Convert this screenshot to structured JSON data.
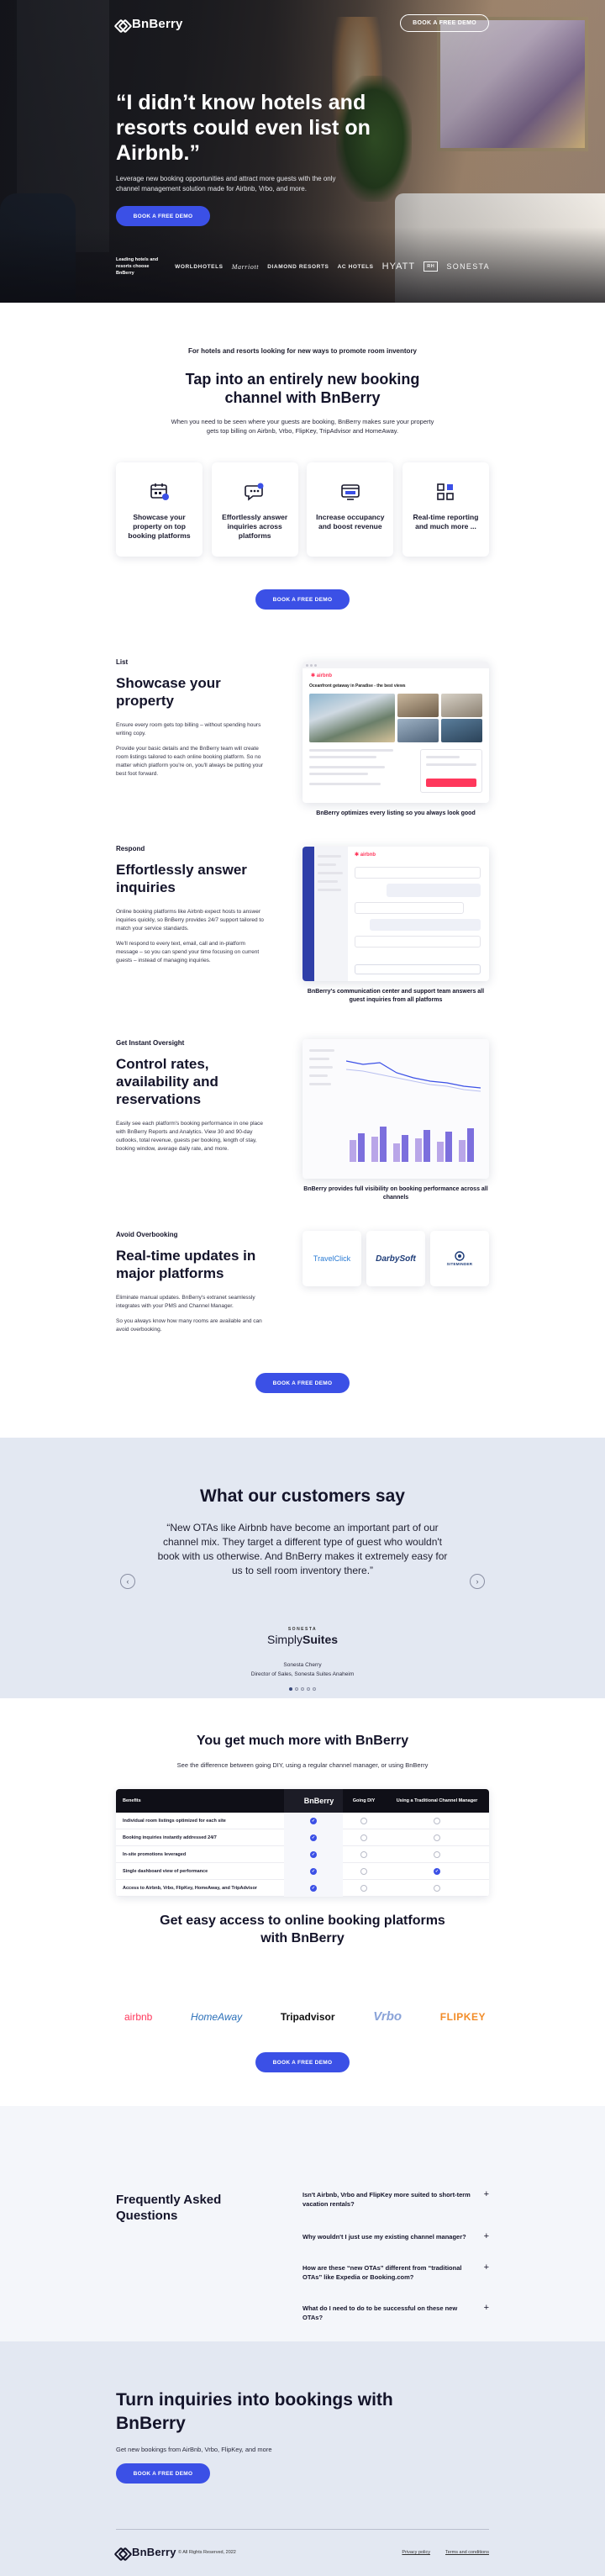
{
  "brand": {
    "name": "BnBerry",
    "accent": "#3b50e6"
  },
  "hero": {
    "cta_top": "BOOK A FREE DEMO",
    "headline": "“I didn’t know hotels and resorts could even list on Airbnb.”",
    "subtitle": "Leverage new booking opportunities and attract more guests with the only channel management solution made for Airbnb, Vrbo, and more.",
    "cta": "BOOK A FREE DEMO",
    "partners_lead": "Leading hotels and resorts choose BnBerry",
    "partners": [
      "WORLDHOTELS",
      "Marriott",
      "DIAMOND RESORTS",
      "AC HOTELS",
      "HYATT",
      "RH",
      "SONESTA"
    ]
  },
  "intro": {
    "kicker": "For hotels and resorts looking for new ways to promote room inventory",
    "title": "Tap into an entirely new booking channel with BnBerry",
    "subtitle": "When you need to be seen where your guests are booking, BnBerry makes sure your property gets top billing on Airbnb, Vrbo, FlipKey, TripAdvisor and HomeAway.",
    "cards": [
      {
        "icon": "calendar-listing-icon",
        "label": "Showcase your property on top booking platforms"
      },
      {
        "icon": "chat-bubble-icon",
        "label": "Effortlessly answer inquiries across platforms"
      },
      {
        "icon": "occupancy-icon",
        "label": "Increase occupancy and boost revenue"
      },
      {
        "icon": "grid-report-icon",
        "label": "Real-time reporting and much more ..."
      }
    ],
    "cta": "BOOK A FREE DEMO"
  },
  "features": [
    {
      "label": "List",
      "title": "Showcase your property",
      "body": [
        "Ensure every room gets top billing – without spending hours writing copy.",
        "Provide your basic details and the BnBerry team will create room listings tailored to each online booking platform. So no matter which platform you're on, you'll always be putting your best foot forward."
      ],
      "caption": "BnBerry optimizes every listing so you always look good",
      "mock_title": "Oceanfront getaway in Paradise - the best views"
    },
    {
      "label": "Respond",
      "title": "Effortlessly answer inquiries",
      "body": [
        "Online booking platforms like Airbnb expect hosts to answer inquiries quickly, so BnBerry provides 24/7 support tailored to match your service standards.",
        "We'll respond to every text, email, call and in-platform message – so you can spend your time focusing on current guests – instead of managing inquiries."
      ],
      "caption": "BnBerry's communication center and support team answers all guest inquiries from all platforms"
    },
    {
      "label": "Get Instant Oversight",
      "title": "Control rates, availability and reservations",
      "body": [
        "Easily see each platform's booking performance in one place with BnBerry Reports and Analytics. View 30 and 90-day outlooks, total revenue, guests per booking, length of stay, booking window, average daily rate, and more."
      ],
      "caption": "BnBerry provides full visibility on booking performance across all channels"
    },
    {
      "label": "Avoid Overbooking",
      "title": "Real-time updates in major platforms",
      "body": [
        "Eliminate manual updates. BnBerry's extranet seamlessly integrates with your PMS and Channel Manager.",
        "So you always know how many rooms are available and can avoid overbooking."
      ],
      "partners": [
        "TravelClick",
        "DarbySoft",
        "SITEMINDER"
      ],
      "cta": "BOOK A FREE DEMO"
    }
  ],
  "testimonial": {
    "title": "What our customers say",
    "quote": "“New OTAs like Airbnb have become an important part of our channel mix. They target a different type of guest who wouldn't book with us otherwise. And BnBerry makes it extremely easy for us to sell room inventory there.”",
    "brand_small": "SONESTA",
    "brand_big_1": "Simply",
    "brand_big_2": "Suites",
    "person": "Sonesta Cherry",
    "role": "Director of Sales, Sonesta Suites Anaheim",
    "prev": "‹",
    "next": "›"
  },
  "comparison": {
    "title": "You get much more with BnBerry",
    "subtitle": "See the difference between going DIY, using a regular channel manager, or using BnBerry",
    "headers": [
      "Benefits",
      "BnBerry",
      "Going DIY",
      "Using a Traditional Channel Manager"
    ],
    "rows": [
      {
        "label": "Individual room listings optimized for each site",
        "bnberry": true,
        "diy": false,
        "tcm": false
      },
      {
        "label": "Booking inquiries instantly addressed 24/7",
        "bnberry": true,
        "diy": false,
        "tcm": false
      },
      {
        "label": "In-site promotions leveraged",
        "bnberry": true,
        "diy": false,
        "tcm": false
      },
      {
        "label": "Single dashboard view of performance",
        "bnberry": true,
        "diy": false,
        "tcm": true
      },
      {
        "label": "Access to Airbnb, Vrbo, FlipKey, HomeAway, and TripAdvisor",
        "bnberry": true,
        "diy": false,
        "tcm": false
      }
    ]
  },
  "easy_access": {
    "title": "Get easy access to online booking platforms with BnBerry",
    "logos": [
      "airbnb",
      "HomeAway",
      "Tripadvisor",
      "Vrbo",
      "FLIPKEY"
    ],
    "cta": "BOOK A FREE DEMO"
  },
  "faq": {
    "title": "Frequently Asked Questions",
    "items": [
      "Isn't Airbnb, Vrbo and FlipKey more suited to short-term vacation rentals?",
      "Why wouldn't I just use my existing channel manager?",
      "How are these “new OTAs” different from “traditional OTAs” like Expedia or Booking.com?",
      "What do I need to do to be successful on these new OTAs?"
    ],
    "toggle": "+"
  },
  "cta": {
    "title": "Turn inquiries into bookings with BnBerry",
    "subtitle": "Get new bookings from AirBnb, Vrbo, FlipKey, and more",
    "button": "BOOK A FREE DEMO"
  },
  "footer": {
    "copyright": "© All Rights Reserved, 2022",
    "links": [
      "Privacy policy",
      "Terms and conditions"
    ]
  }
}
